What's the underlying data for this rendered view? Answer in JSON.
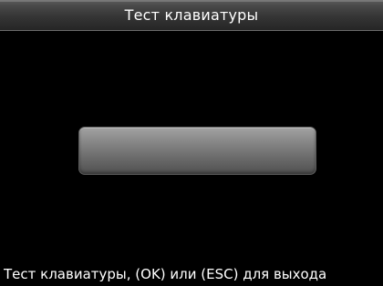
{
  "header": {
    "title": "Тест клавиатуры"
  },
  "main": {
    "key_display_value": ""
  },
  "footer": {
    "hint": "Тест клавиатуры, (OK) или (ESC) для выхода"
  },
  "colors": {
    "background": "#000000",
    "text": "#ffffff",
    "title_bar": "#3a3a3a",
    "key_display": "#7a7a7a"
  }
}
